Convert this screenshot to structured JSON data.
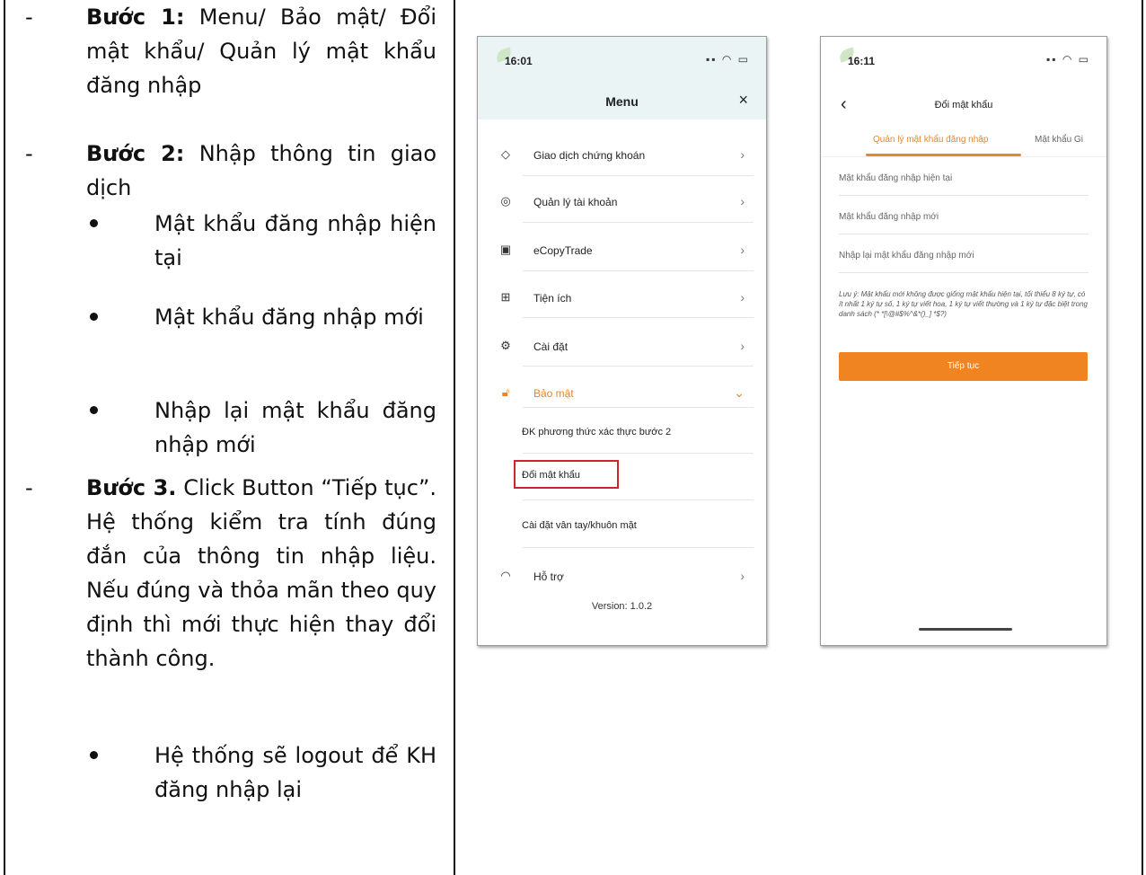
{
  "steps": {
    "step1": {
      "label": "Bước 1:",
      "text": " Menu/ Bảo mật/ Đổi mật khẩu/ Quản lý mật khẩu đăng nhập"
    },
    "step2": {
      "label": "Bước 2:",
      "text": " Nhập thông tin giao dịch"
    },
    "step2_bullets": [
      "Mật khẩu đăng nhập hiện tại",
      "Mật khẩu đăng nhập mới",
      "Nhập lại mật khẩu đăng nhập mới"
    ],
    "step3": {
      "label": "Bước 3.",
      "text": " Click Button “Tiếp tục”. Hệ thống kiểm tra tính đúng đắn của thông tin nhập liệu. Nếu đúng và thỏa mãn theo quy định thì mới thực hiện thay đổi thành công."
    },
    "step3_bullets": [
      "Hệ thống sẽ logout để KH đăng nhập lại"
    ],
    "dash": "-"
  },
  "phone_menu": {
    "time": "16:01",
    "title": "Menu",
    "close": "×",
    "items": [
      {
        "label": "Giao dịch chứng khoán",
        "icon": "tag-icon",
        "chevron": "›"
      },
      {
        "label": "Quản lý tài khoản",
        "icon": "user-circle-icon",
        "chevron": "›"
      },
      {
        "label": "eCopyTrade",
        "icon": "document-icon",
        "chevron": "›"
      },
      {
        "label": "Tiện ích",
        "icon": "grid-plus-icon",
        "chevron": "›"
      },
      {
        "label": "Cài đặt",
        "icon": "gear-icon",
        "chevron": "›"
      },
      {
        "label": "Bảo mật",
        "icon": "lock-icon",
        "chevron": "⌄"
      }
    ],
    "sub_items": [
      "ĐK phương thức xác thực bước 2",
      "Đổi mật khẩu",
      "Cài đặt vân tay/khuôn mặt"
    ],
    "support": {
      "label": "Hỗ trợ",
      "icon": "headset-icon",
      "chevron": "›"
    },
    "version": "Version: 1.0.2",
    "accent_color": "#e8862b",
    "highlight_color": "#d0222f"
  },
  "phone_password": {
    "time": "16:11",
    "back": "‹",
    "title": "Đổi mật khẩu",
    "tabs": [
      "Quản lý mật khẩu đăng nhập",
      "Mật khẩu Gi"
    ],
    "fields": [
      "Mật khẩu đăng nhập hiện tại",
      "Mật khẩu đăng nhập mới",
      "Nhập lại mật khẩu đăng nhập mới"
    ],
    "note": "Lưu ý: Mật khẩu mới không được giống mật khẩu hiện tại, tối thiểu 8 ký tự, có ít nhất 1 ký tự số, 1 ký tự viết hoa, 1 ký tự viết thường và 1 ký tự đặc biệt trong danh sách (* *[\\@#$%^&*()_] *$?)",
    "button": "Tiếp tục",
    "button_color": "#f08421"
  }
}
